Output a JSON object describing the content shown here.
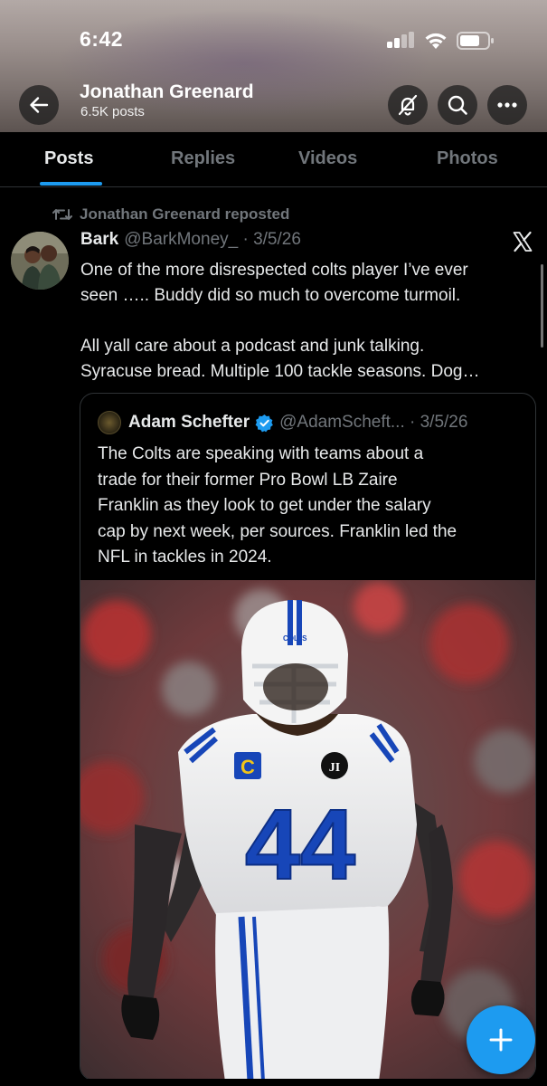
{
  "status_bar": {
    "time": "6:42"
  },
  "header": {
    "profile_name": "Jonathan Greenard",
    "post_count": "6.5K posts",
    "icons": [
      "back-arrow-icon",
      "no-notifications-icon",
      "search-icon",
      "more-icon"
    ]
  },
  "tabs": [
    {
      "label": "Posts",
      "active": true
    },
    {
      "label": "Replies",
      "active": false
    },
    {
      "label": "Videos",
      "active": false
    },
    {
      "label": "Photos",
      "active": false
    }
  ],
  "post": {
    "repost_label": "Jonathan Greenard reposted",
    "author": "Bark",
    "handle_date": "@BarkMoney_ · 3/5/26",
    "text_lines": [
      "One of the more disrespected colts player I’ve ever",
      "seen ….. Buddy did so much to overcome turmoil.",
      "",
      "All yall care about a podcast and junk talking.",
      "Syracuse bread. Multiple 100 tackle seasons. Dog…"
    ]
  },
  "quote": {
    "author": "Adam Schefter",
    "handle_date": "@AdamScheft... · 3/5/26",
    "text_lines": [
      "The Colts are speaking with teams about a",
      "trade for their former Pro Bowl LB Zaire",
      "Franklin as they look to get under the salary",
      "cap by next week, per sources. Franklin led the",
      "NFL in tackles in 2024."
    ],
    "image": {
      "jersey_number": "44",
      "helmet_text": "COLTS",
      "captain_patch": "C",
      "memorial_patch": "JI"
    }
  },
  "colors": {
    "accent": "#1d9bf0",
    "background": "#000000",
    "text_primary": "#e7e9ea",
    "text_secondary": "#71767b",
    "colts_blue": "#1746b8"
  }
}
